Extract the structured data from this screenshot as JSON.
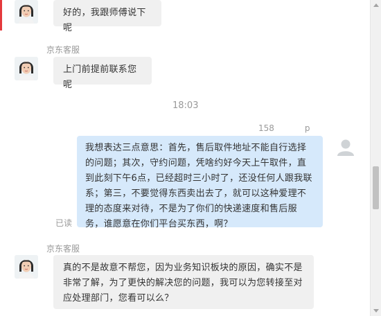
{
  "messages": [
    {
      "from": "agent",
      "text": "好的，我跟师傅说下呢"
    },
    {
      "sender": "京东客服",
      "from": "agent",
      "text": "上门前提前联系您呢"
    },
    {
      "time": "18:03"
    },
    {
      "sender": "158",
      "from": "user",
      "text": "我想表达三点意思：首先，售后取件地址不能自行选择的问题；其次，守约问题，凭啥约好今天上午取件，直到此刻下午6点，已经超时三小时了，还没任何人跟我联系；第三，不要觉得东西卖出去了，就可以这种爱理不理的态度来对待，不是为了你们的快递速度和售后服务，谁愿意在你们平台买东西，啊？",
      "status": "已读"
    },
    {
      "sender": "京东客服",
      "from": "agent",
      "text": "真的不是故意不帮您，因为业务知识板块的原因，确实不是非常了解，为了更快的解决您的问题，我可以为您转接至对应处理部门，您看可以么？"
    }
  ],
  "icons": {
    "agent_avatar": "agent-avatar",
    "user_avatar": "user-avatar-icon",
    "scroll_up": "chevron-up-icon",
    "scroll_down": "chevron-down-icon"
  },
  "colors": {
    "accent": "#e4393c",
    "outgoing_bubble": "#d6e9fb",
    "incoming_bubble": "#f0f0f0"
  }
}
